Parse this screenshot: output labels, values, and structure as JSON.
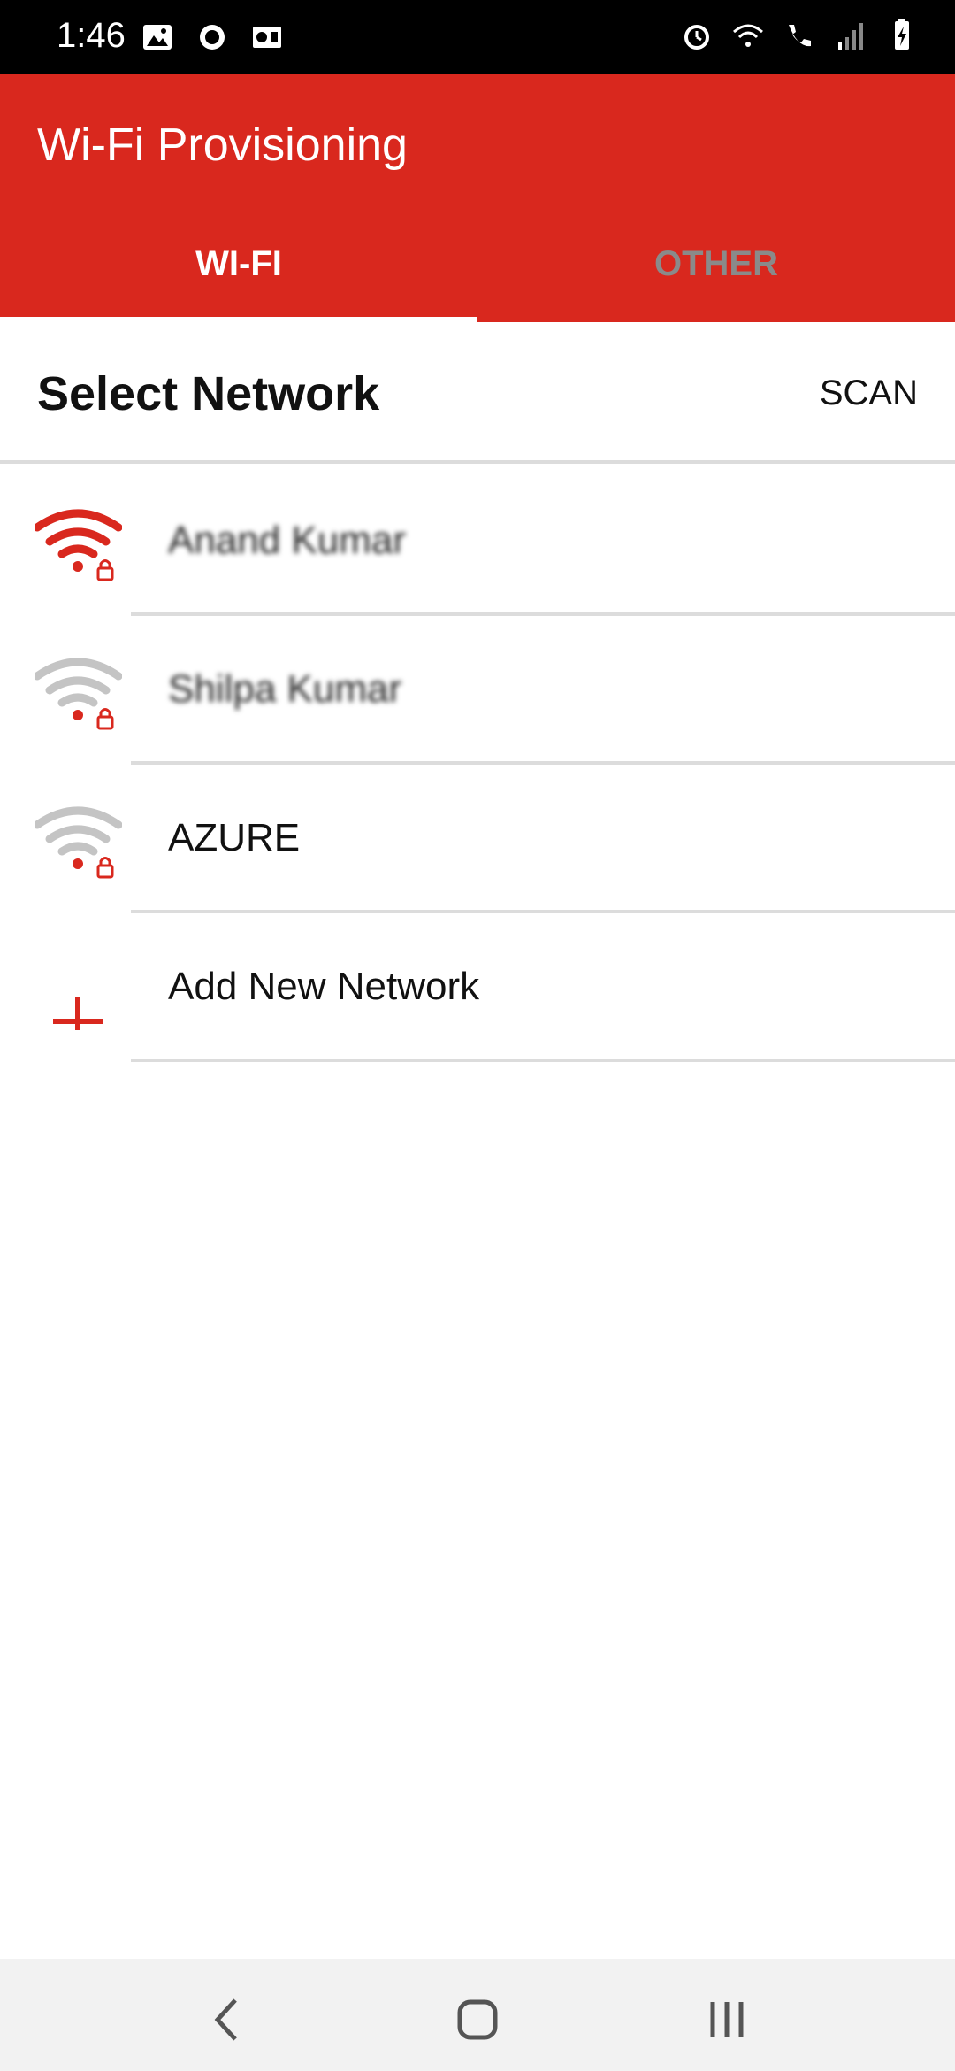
{
  "status_bar": {
    "time": "1:46",
    "left_icons": [
      "gallery-icon",
      "notification-badge-icon",
      "outlook-icon"
    ],
    "right_icons": [
      "alarm-icon",
      "wifi-icon",
      "wifi-calling-icon",
      "signal-icon",
      "battery-icon"
    ]
  },
  "app_bar": {
    "title": "Wi-Fi Provisioning",
    "accent_color": "#d9281e"
  },
  "tabs": [
    {
      "label": "WI-FI",
      "selected": true
    },
    {
      "label": "OTHER",
      "selected": false
    }
  ],
  "header": {
    "title": "Select Network",
    "scan_label": "SCAN"
  },
  "networks": [
    {
      "name": "Anand Kumar",
      "icon": "wifi-locked-icon",
      "active": true
    },
    {
      "name": "Shilpa Kumar",
      "icon": "wifi-locked-icon",
      "active": false
    },
    {
      "name": "AZURE",
      "icon": "wifi-locked-icon",
      "active": false
    }
  ],
  "add_network": {
    "label": "Add New Network",
    "icon": "plus-icon"
  },
  "nav_bar": {
    "buttons": [
      "back-icon",
      "home-icon",
      "recents-icon"
    ]
  }
}
